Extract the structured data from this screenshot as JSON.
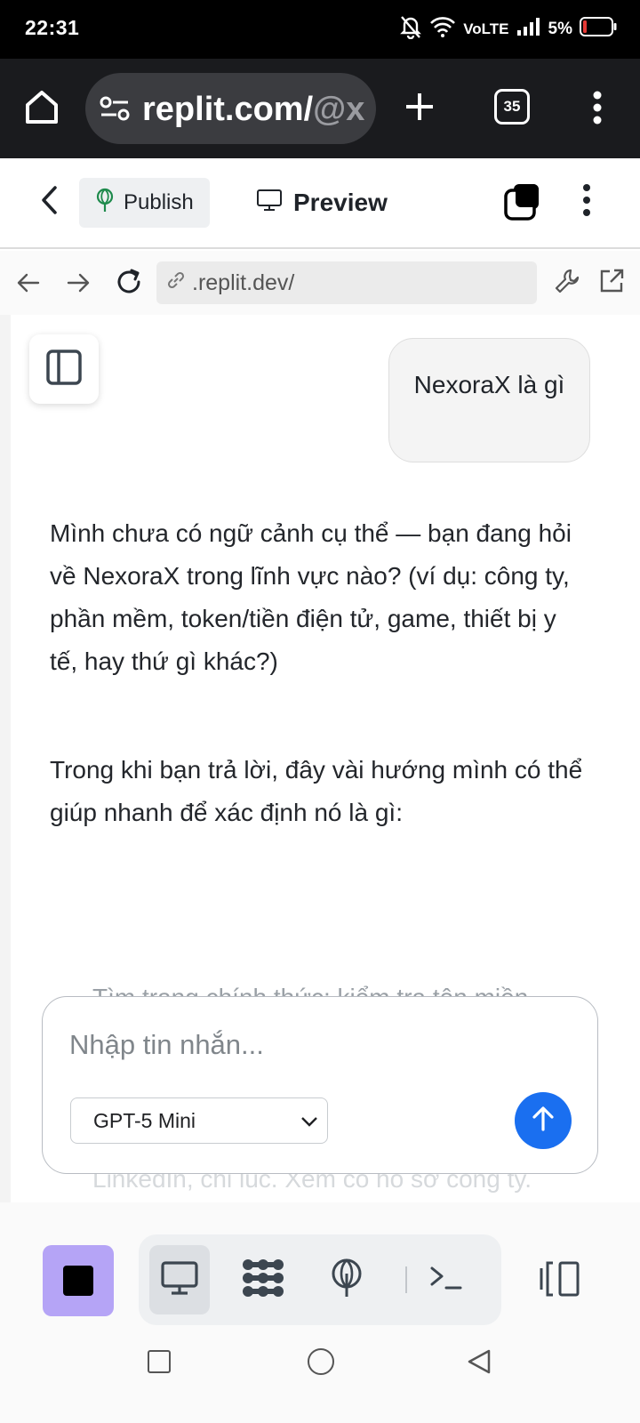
{
  "status_bar": {
    "time": "22:31",
    "network": "VoLTE",
    "battery": "5%"
  },
  "browser": {
    "url_main": "replit.com/",
    "url_faded": "@x",
    "tab_count": "35"
  },
  "replit_header": {
    "publish_label": "Publish",
    "preview_label": "Preview"
  },
  "webview_nav": {
    "address": ".replit.dev/"
  },
  "chat": {
    "user_message": "NexoraX là gì",
    "answer_paragraphs": [
      "Mình chưa có ngữ cảnh cụ thể — bạn đang hỏi về NexoraX trong lĩnh vực nào? (ví dụ: công ty, phần mềm, token/tiền điện tử, game, thiết bị y tế, hay thứ gì khác?)",
      "Trong khi bạn trả lời, đây vài hướng mình có thể giúp nhanh để xác định nó là gì:"
    ],
    "faded_line_1": "Tìm trang chính thức: kiểm tra tên miền",
    "faded_line_2": "LinkedIn, chỉ lúc. Xem có hồ sơ công ty."
  },
  "composer": {
    "placeholder": "Nhập tin nhắn...",
    "model": "GPT-5 Mini"
  },
  "colors": {
    "accent_blue": "#1a6ff0",
    "stop_purple": "#b5a4f6",
    "publish_green": "#1e8a4c"
  }
}
